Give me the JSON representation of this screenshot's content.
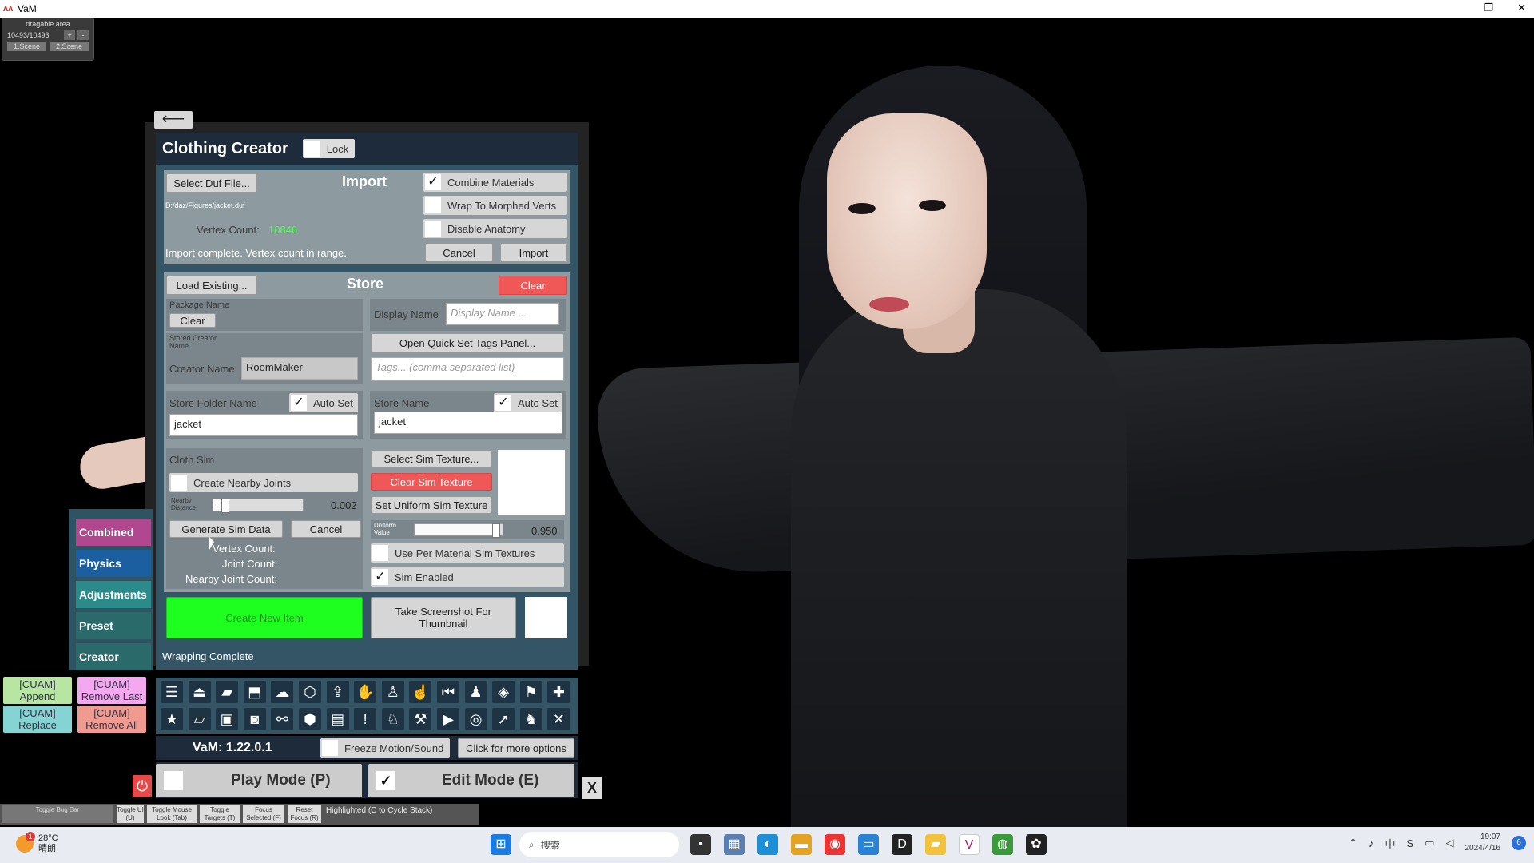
{
  "window": {
    "title": "VaM",
    "app_icon": "vam-logo-icon",
    "restore_glyph": "❐",
    "close_glyph": "✕"
  },
  "drag_widget": {
    "title": "dragable area",
    "count": "10493/10493",
    "plus": "+",
    "minus": "-",
    "scene1": "1.Scene",
    "scene2": "2.Scene"
  },
  "back_glyph": "⟵",
  "panel": {
    "title": "Clothing Creator",
    "lock_label": "Lock"
  },
  "import": {
    "heading": "Import",
    "select_duf": "Select Duf File...",
    "path": "D:/daz/Figures/jacket.duf",
    "vertex_count_label": "Vertex Count:",
    "vertex_count_value": "10846",
    "status": "Import complete. Vertex count in range.",
    "combine_materials": "Combine Materials",
    "combine_materials_checked": "✓",
    "wrap_morphed": "Wrap To Morphed Verts",
    "disable_anatomy": "Disable Anatomy",
    "cancel": "Cancel",
    "import": "Import"
  },
  "store": {
    "heading": "Store",
    "load_existing": "Load Existing...",
    "clear": "Clear",
    "package_name_label": "Package Name",
    "package_clear": "Clear",
    "stored_creator_label": "Stored Creator Name",
    "creator_name_label": "Creator Name",
    "creator_name_value": "RoomMaker",
    "display_name_label": "Display Name",
    "display_name_placeholder": "Display Name ...",
    "open_tags": "Open Quick Set Tags Panel...",
    "tags_placeholder": "Tags... (comma separated list)",
    "store_folder_label": "Store Folder Name",
    "auto_set": "Auto Set",
    "auto_set_checked": "✓",
    "store_folder_value": "jacket",
    "store_name_label": "Store Name",
    "store_name_value": "jacket"
  },
  "sim": {
    "cloth_sim_label": "Cloth Sim",
    "create_nearby_joints": "Create Nearby Joints",
    "nearby_distance_label": "Nearby Distance",
    "nearby_distance_value": "0.002",
    "nearby_distance_fraction": 0.1,
    "generate": "Generate Sim Data",
    "cancel": "Cancel",
    "vertex_count_label": "Vertex Count:",
    "joint_count_label": "Joint Count:",
    "nearby_joint_count_label": "Nearby Joint Count:",
    "select_texture": "Select Sim Texture...",
    "clear_texture": "Clear Sim Texture",
    "set_uniform": "Set Uniform Sim Texture",
    "uniform_value_label": "Uniform Value",
    "uniform_value": "0.950",
    "uniform_fraction": 0.95,
    "per_material": "Use Per Material Sim Textures",
    "sim_enabled": "Sim Enabled",
    "sim_enabled_checked": "✓"
  },
  "create": {
    "create_new_item": "Create New Item",
    "screenshot": "Take Screenshot For Thumbnail",
    "wrapping_status": "Wrapping Complete"
  },
  "tabs": [
    {
      "label": "Combined",
      "color": "#b0478f"
    },
    {
      "label": "Physics",
      "color": "#1c5fa0"
    },
    {
      "label": "Adjustments",
      "color": "#2b8a8a"
    },
    {
      "label": "Preset",
      "color": "#2b6a6a"
    },
    {
      "label": "Creator",
      "color": "#2b6a6a"
    }
  ],
  "cuam": {
    "append": "[CUAM] Append",
    "remove_last": "[CUAM] Remove Last",
    "replace": "[CUAM] Replace",
    "remove_all": "[CUAM] Remove All"
  },
  "toolbar": {
    "row1": [
      {
        "icon": "menu-icon",
        "glyph": "☰"
      },
      {
        "icon": "load-scene-icon",
        "glyph": "⏏"
      },
      {
        "icon": "open-folder-icon",
        "glyph": "▰"
      },
      {
        "icon": "save-red-icon",
        "glyph": "⬒"
      },
      {
        "icon": "cloud-icon",
        "glyph": "☁"
      },
      {
        "icon": "package-icon",
        "glyph": "⬡"
      },
      {
        "icon": "export-icon",
        "glyph": "⇪"
      },
      {
        "icon": "hand-icon",
        "glyph": "✋"
      },
      {
        "icon": "person-settings-icon",
        "glyph": "♙"
      },
      {
        "icon": "pointer-hand-icon",
        "glyph": "☝"
      },
      {
        "icon": "skip-back-icon",
        "glyph": "⏮"
      },
      {
        "icon": "person-icon",
        "glyph": "♟"
      },
      {
        "icon": "unity-icon",
        "glyph": "◈"
      },
      {
        "icon": "flag-icon",
        "glyph": "⚑"
      },
      {
        "icon": "add-icon",
        "glyph": "✚"
      }
    ],
    "row2": [
      {
        "icon": "star-icon",
        "glyph": "★"
      },
      {
        "icon": "open-folder-icon",
        "glyph": "▱"
      },
      {
        "icon": "folder-image-icon",
        "glyph": "▣"
      },
      {
        "icon": "camera-icon",
        "glyph": "◙"
      },
      {
        "icon": "graph-icon",
        "glyph": "⚯"
      },
      {
        "icon": "unity-box-icon",
        "glyph": "⬢"
      },
      {
        "icon": "document-icon",
        "glyph": "▤"
      },
      {
        "icon": "alert-icon",
        "glyph": "!"
      },
      {
        "icon": "person-edit-icon",
        "glyph": "♘"
      },
      {
        "icon": "wrench-icon",
        "glyph": "⚒"
      },
      {
        "icon": "play-icon",
        "glyph": "▶"
      },
      {
        "icon": "target-icon",
        "glyph": "◎"
      },
      {
        "icon": "cursor-icon",
        "glyph": "➚"
      },
      {
        "icon": "people-icon",
        "glyph": "♞"
      },
      {
        "icon": "tools-icon",
        "glyph": "✕"
      }
    ]
  },
  "version": {
    "label": "VaM: 1.22.0.1",
    "freeze": "Freeze Motion/Sound",
    "more_options": "Click for more options"
  },
  "modes": {
    "play": "Play Mode (P)",
    "edit": "Edit Mode (E)",
    "edit_checked": "✓",
    "close": "X",
    "power": "⏻"
  },
  "hints": [
    "Toggle UI (U)",
    "Toggle Mouse Look (Tab)",
    "Toggle Targets (T)",
    "Focus Selected (F)",
    "Reset Focus (R)"
  ],
  "hint_left": "Toggle Bug Bar",
  "hint_highlight": "Highlighted (C to Cycle Stack)",
  "taskbar": {
    "temp": "28°C",
    "weather": "晴朗",
    "badge": "1",
    "search": "搜索",
    "time": "19:07",
    "date": "2024/4/16",
    "notifications": "6"
  }
}
